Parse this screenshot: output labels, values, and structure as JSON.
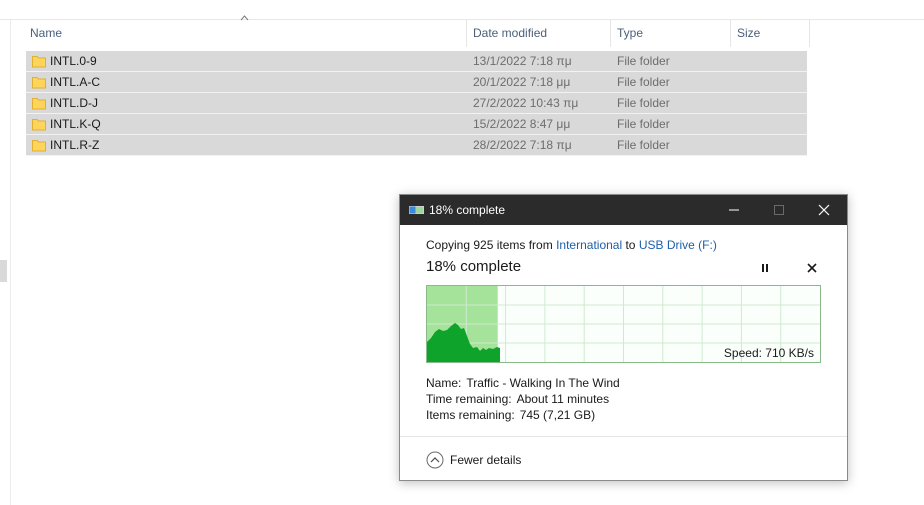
{
  "explorer": {
    "columns": {
      "name": "Name",
      "date_modified": "Date modified",
      "type": "Type",
      "size": "Size"
    },
    "rows": [
      {
        "name": "INTL.0-9",
        "date": "13/1/2022 7:18 πμ",
        "type": "File folder"
      },
      {
        "name": "INTL.A-C",
        "date": "20/1/2022 7:18 μμ",
        "type": "File folder"
      },
      {
        "name": "INTL.D-J",
        "date": "27/2/2022 10:43 πμ",
        "type": "File folder"
      },
      {
        "name": "INTL.K-Q",
        "date": "15/2/2022 8:47 μμ",
        "type": "File folder"
      },
      {
        "name": "INTL.R-Z",
        "date": "28/2/2022 7:18 πμ",
        "type": "File folder"
      }
    ],
    "colors": {
      "selected_row": "#d9d9d9",
      "folder": "#ffd45a"
    }
  },
  "dialog": {
    "title": "18% complete",
    "copy_prefix": "Copying 925 items from",
    "source": "International",
    "to_word": "to",
    "destination": "USB Drive (F:)",
    "status": "18% complete",
    "progress_fraction": 0.18,
    "speed": "Speed: 710 KB/s",
    "name_key": "Name:",
    "name_value": "Traffic - Walking In The Wind",
    "time_key": "Time remaining:",
    "time_value": "About 11 minutes",
    "items_key": "Items remaining:",
    "items_value": "745 (7,21 GB)",
    "fewer_details": "Fewer details",
    "colors": {
      "titlebar": "#2b2b2b",
      "graph_fill": "#a6e39a",
      "graph_area": "#0ea32a",
      "link": "#1e5fa8"
    },
    "icons": [
      "copy-transfer-icon",
      "minimize-icon",
      "maximize-icon",
      "close-icon",
      "pause-icon",
      "cancel-icon",
      "chevron-up-circle-icon"
    ]
  }
}
